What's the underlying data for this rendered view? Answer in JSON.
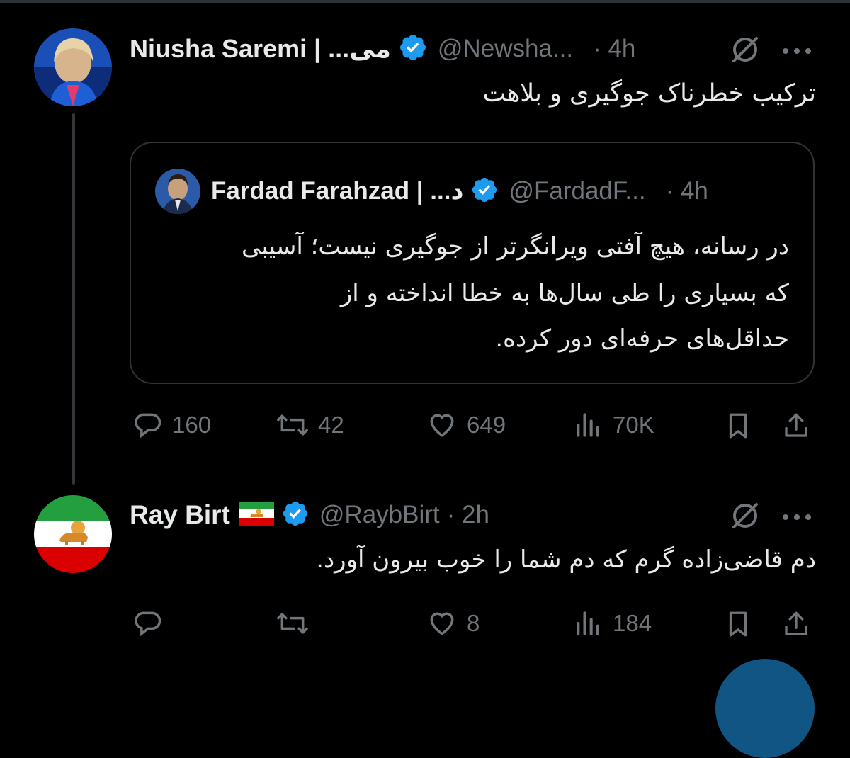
{
  "tweet1": {
    "display_name": "Niusha Saremi | ...می",
    "handle": "@Newsha...",
    "time": "· 4h",
    "text": "ترکیب خطرناک جوگیری و بلاهت",
    "quoted": {
      "display_name": "Fardad Farahzad | ...د",
      "handle": "@FardadF...",
      "time": "· 4h",
      "text_lines": [
        "در رسانه، هیچ آفتی ویرانگرتر از جوگیری نیست؛ آسیبی",
        "که بسیاری را طی سال‌ها به خطا انداخته و از",
        "حداقل‌های حرفه‌ای دور کرده."
      ]
    },
    "stats": {
      "replies": "160",
      "reposts": "42",
      "likes": "649",
      "views": "70K"
    }
  },
  "tweet2": {
    "display_name": "Ray Birt",
    "handle": "@RaybBirt",
    "time": "· 2h",
    "text": "دم قاضی‌زاده گرم که دم شما را خوب بیرون آورد.",
    "stats": {
      "replies": "",
      "reposts": "",
      "likes": "8",
      "views": "184"
    }
  },
  "colors": {
    "background": "#000000",
    "text": "#e7e9ea",
    "secondary": "#71767b",
    "border": "#2f3336",
    "verified": "#1d9bf0"
  },
  "icons": [
    "verified-badge-icon",
    "grok-icon",
    "more-icon",
    "reply-icon",
    "repost-icon",
    "like-icon",
    "views-icon",
    "bookmark-icon",
    "share-icon",
    "iran-lion-sun-flag-icon"
  ]
}
